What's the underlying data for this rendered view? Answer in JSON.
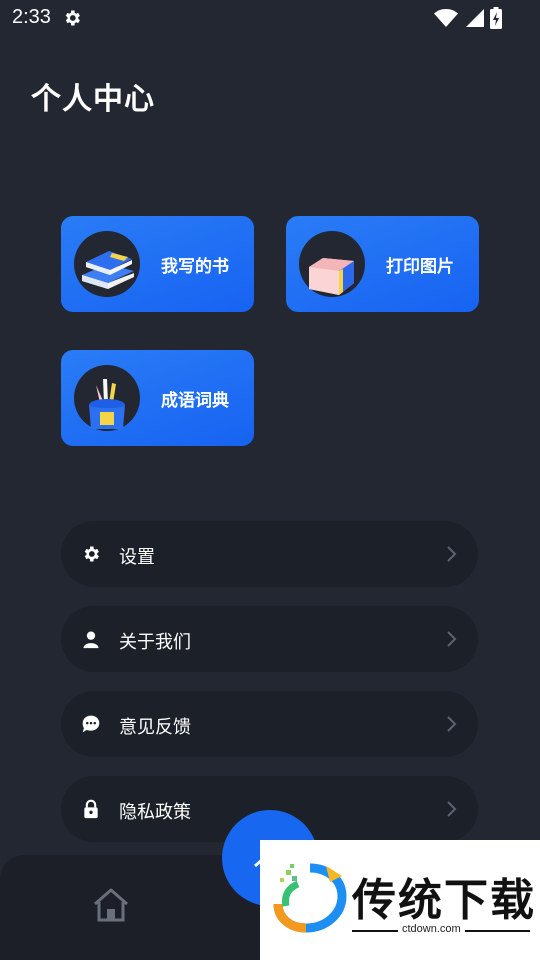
{
  "status_bar": {
    "time": "2:33"
  },
  "header": {
    "title": "个人中心"
  },
  "cards": {
    "my_books": {
      "label": "我写的书",
      "icon": "books-icon"
    },
    "print_images": {
      "label": "打印图片",
      "icon": "print-box-icon"
    },
    "idiom_dictionary": {
      "label": "成语词典",
      "icon": "pencil-cup-icon"
    }
  },
  "menu": [
    {
      "label": "设置",
      "icon": "gear-icon"
    },
    {
      "label": "关于我们",
      "icon": "person-icon"
    },
    {
      "label": "意见反馈",
      "icon": "chat-bubble-icon"
    },
    {
      "label": "隐私政策",
      "icon": "lock-icon"
    }
  ],
  "bottom_nav": {
    "home_icon": "home-icon"
  },
  "watermark": {
    "title": "传统下载",
    "subtitle": "ctdown.com"
  },
  "colors": {
    "background": "#232731",
    "accent": "#1767f1",
    "menu_bg": "#1c2028"
  }
}
